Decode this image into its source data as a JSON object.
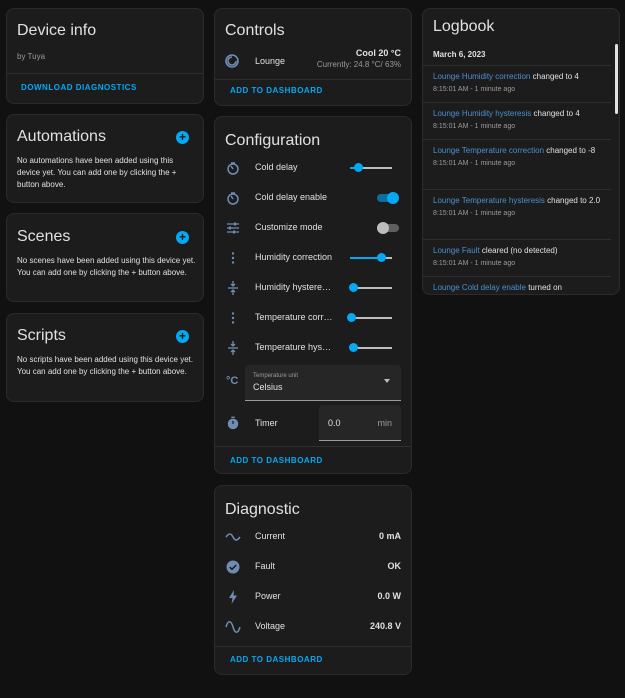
{
  "colors": {
    "accent": "#03a9f4",
    "background": "#111111",
    "card": "#1c1c1c",
    "link": "#4d8fd1"
  },
  "device_info": {
    "title": "Device info",
    "manufacturer": "by Tuya",
    "download_label": "DOWNLOAD DIAGNOSTICS"
  },
  "automations": {
    "title": "Automations",
    "empty_text": "No automations have been added using this device yet. You can add one by clicking the + button above."
  },
  "scenes": {
    "title": "Scenes",
    "empty_text": "No scenes have been added using this device yet. You can add one by clicking the + button above."
  },
  "scripts": {
    "title": "Scripts",
    "empty_text": "No scripts have been added using this device yet. You can add one by clicking the + button above."
  },
  "controls": {
    "title": "Controls",
    "entity_name": "Lounge",
    "state": "Cool 20 °C",
    "current": "Currently: 24.8 °C/ 63%",
    "add_label": "ADD TO DASHBOARD"
  },
  "configuration": {
    "title": "Configuration",
    "cold_delay": {
      "label": "Cold delay",
      "level": 0.18
    },
    "cold_delay_enable": {
      "label": "Cold delay enable",
      "on": true
    },
    "customize_mode": {
      "label": "Customize mode",
      "on": false
    },
    "humidity_correction": {
      "label": "Humidity correction",
      "level": 0.73
    },
    "humidity_hysteresis": {
      "label": "Humidity hysteresis",
      "level": 0.08
    },
    "temperature_correction": {
      "label": "Temperature corr…",
      "level": 0.03
    },
    "temperature_hysteresis": {
      "label": "Temperature hyst…",
      "level": 0.08
    },
    "temperature_unit": {
      "field_label": "Temperature unit",
      "value": "Celsius"
    },
    "timer": {
      "label": "Timer",
      "value": "0.0",
      "unit": "min"
    },
    "add_label": "ADD TO DASHBOARD"
  },
  "diagnostic": {
    "title": "Diagnostic",
    "current": {
      "label": "Current",
      "value": "0 mA"
    },
    "fault": {
      "label": "Fault",
      "value": "OK"
    },
    "power": {
      "label": "Power",
      "value": "0.0 W"
    },
    "voltage": {
      "label": "Voltage",
      "value": "240.8 V"
    },
    "add_label": "ADD TO DASHBOARD"
  },
  "logbook": {
    "title": "Logbook",
    "date": "March 6, 2023",
    "entries": [
      {
        "entity": "Lounge Humidity correction",
        "message": " changed to 4",
        "time": "8:15:01 AM - 1 minute ago"
      },
      {
        "entity": "Lounge Humidity hysteresis",
        "message": " changed to 4",
        "time": "8:15:01 AM - 1 minute ago"
      },
      {
        "entity": "Lounge Temperature correction",
        "message": " changed to -8",
        "time": "8:15:01 AM - 1 minute ago"
      },
      {
        "entity": "Lounge Temperature hysteresis",
        "message": " changed to 2.0",
        "time": "8:15:01 AM - 1 minute ago"
      },
      {
        "entity": "Lounge Fault",
        "message": " cleared (no detected)",
        "time": "8:15:01 AM - 1 minute ago"
      },
      {
        "entity": "Lounge Cold delay enable",
        "message": " turned on",
        "time": ""
      }
    ]
  }
}
